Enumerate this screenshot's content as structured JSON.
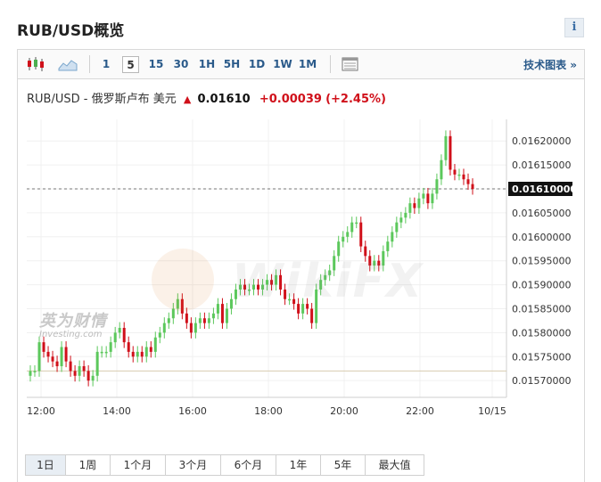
{
  "page": {
    "title": "RUB/USD概览",
    "info_label": "i"
  },
  "toolbar": {
    "intervals": [
      "1",
      "5",
      "15",
      "30",
      "1H",
      "5H",
      "1D",
      "1W",
      "1M"
    ],
    "active_interval": "5",
    "tech_link": "技术图表 »",
    "icons": [
      "candlestick-icon",
      "area-chart-icon",
      "table-view-icon"
    ]
  },
  "quote": {
    "symbol": "RUB/USD - 俄罗斯卢布 美元",
    "arrow": "▲",
    "price": "0.01610",
    "change": "+0.00039",
    "change_pct": "(+2.45%)"
  },
  "colors": {
    "up": "#5cc85c",
    "down": "#d0101a",
    "accent": "#2a5a8a"
  },
  "watermark": {
    "brand": "WikiFX",
    "logo_cn": "英为财情",
    "logo_en": "Investing.com"
  },
  "chart_data": {
    "type": "candlestick",
    "x_ticks": [
      "12:00",
      "14:00",
      "16:00",
      "18:00",
      "20:00",
      "22:00",
      "10/15"
    ],
    "y_ticks": [
      "0.01620000",
      "0.01615000",
      "0.01610000",
      "0.01605000",
      "0.01600000",
      "0.01595000",
      "0.01590000",
      "0.01585000",
      "0.01580000",
      "0.01575000",
      "0.01570000"
    ],
    "ylim": [
      0.015665,
      0.016245
    ],
    "last_price_label": "0.01610000",
    "last_price": 0.0161,
    "prev_close": 0.01572,
    "grid": true,
    "close": [
      0.01572,
      0.01572,
      0.01578,
      0.01576,
      0.01575,
      0.01574,
      0.01573,
      0.01577,
      0.01574,
      0.01572,
      0.01571,
      0.01573,
      0.01572,
      0.0157,
      0.01571,
      0.01576,
      0.01576,
      0.01576,
      0.01578,
      0.0158,
      0.01581,
      0.01578,
      0.01576,
      0.01575,
      0.01576,
      0.01575,
      0.01577,
      0.01576,
      0.01579,
      0.0158,
      0.01582,
      0.01583,
      0.01585,
      0.01587,
      0.01584,
      0.01582,
      0.0158,
      0.01582,
      0.01583,
      0.01582,
      0.01583,
      0.01584,
      0.01586,
      0.01582,
      0.01585,
      0.01587,
      0.01589,
      0.0159,
      0.01589,
      0.01589,
      0.0159,
      0.01589,
      0.0159,
      0.01591,
      0.0159,
      0.01592,
      0.01589,
      0.01587,
      0.01587,
      0.01586,
      0.01584,
      0.01586,
      0.01585,
      0.01582,
      0.01589,
      0.01591,
      0.01592,
      0.01593,
      0.01596,
      0.01599,
      0.016,
      0.01601,
      0.01603,
      0.01603,
      0.01598,
      0.01596,
      0.01594,
      0.01595,
      0.01594,
      0.01597,
      0.01599,
      0.01601,
      0.01603,
      0.01604,
      0.01605,
      0.01607,
      0.01606,
      0.01608,
      0.01609,
      0.01607,
      0.01609,
      0.01612,
      0.01616,
      0.01621,
      0.01614,
      0.01613,
      0.01613,
      0.01612,
      0.01611,
      0.0161
    ]
  },
  "range_tabs": {
    "items": [
      "1日",
      "1周",
      "1个月",
      "3个月",
      "6个月",
      "1年",
      "5年",
      "最大值"
    ],
    "active": "1日"
  }
}
